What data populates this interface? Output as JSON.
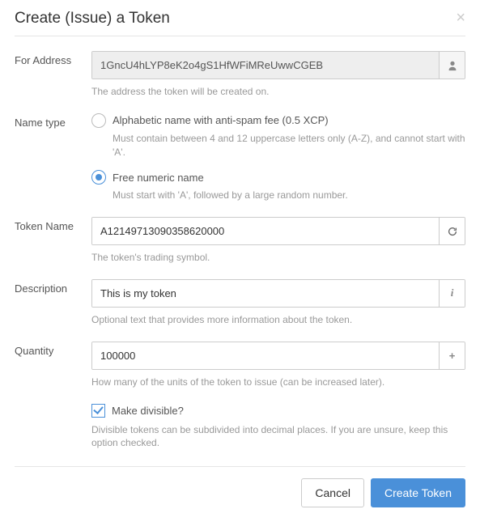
{
  "modal": {
    "title": "Create (Issue) a Token",
    "close": "×"
  },
  "address": {
    "label": "For Address",
    "value": "1GncU4hLYP8eK2o4gS1HfWFiMReUwwCGEB",
    "help": "The address the token will be created on."
  },
  "nameType": {
    "label": "Name type",
    "alpha": {
      "label": "Alphabetic name with anti-spam fee (0.5 XCP)",
      "help": "Must contain between 4 and 12 uppercase letters only (A-Z), and cannot start with 'A'."
    },
    "numeric": {
      "label": "Free numeric name",
      "help": "Must start with 'A', followed by a large random number."
    }
  },
  "tokenName": {
    "label": "Token Name",
    "value": "A12149713090358620000",
    "help": "The token's trading symbol."
  },
  "description": {
    "label": "Description",
    "value": "This is my token",
    "help": "Optional text that provides more information about the token."
  },
  "quantity": {
    "label": "Quantity",
    "value": "100000",
    "help": "How many of the units of the token to issue (can be increased later)."
  },
  "divisible": {
    "label": "Make divisible?",
    "help": "Divisible tokens can be subdivided into decimal places. If you are unsure, keep this option checked."
  },
  "footer": {
    "cancel": "Cancel",
    "create": "Create Token"
  }
}
